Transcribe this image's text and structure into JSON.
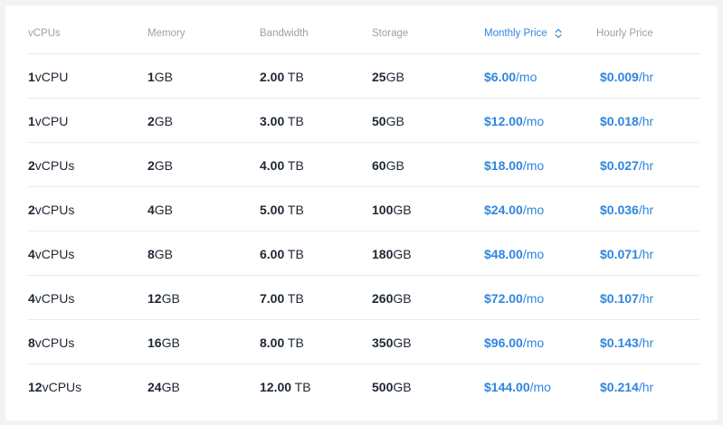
{
  "columns": {
    "vcpus": "vCPUs",
    "memory": "Memory",
    "bandwidth": "Bandwidth",
    "storage": "Storage",
    "monthly": "Monthly Price",
    "hourly": "Hourly Price"
  },
  "sort": {
    "column": "monthly",
    "icon": "sort-updown-icon"
  },
  "accent_color": "#2f86de",
  "rows": [
    {
      "vcpu_num": "1",
      "vcpu_unit": "vCPU",
      "mem_num": "1",
      "mem_unit": "GB",
      "bw_num": "2.00",
      "bw_unit": " TB",
      "st_num": "25",
      "st_unit": "GB",
      "mo_num": "$6.00",
      "mo_unit": "/mo",
      "hr_num": "$0.009",
      "hr_unit": "/hr"
    },
    {
      "vcpu_num": "1",
      "vcpu_unit": "vCPU",
      "mem_num": "2",
      "mem_unit": "GB",
      "bw_num": "3.00",
      "bw_unit": " TB",
      "st_num": "50",
      "st_unit": "GB",
      "mo_num": "$12.00",
      "mo_unit": "/mo",
      "hr_num": "$0.018",
      "hr_unit": "/hr"
    },
    {
      "vcpu_num": "2",
      "vcpu_unit": "vCPUs",
      "mem_num": "2",
      "mem_unit": "GB",
      "bw_num": "4.00",
      "bw_unit": " TB",
      "st_num": "60",
      "st_unit": "GB",
      "mo_num": "$18.00",
      "mo_unit": "/mo",
      "hr_num": "$0.027",
      "hr_unit": "/hr"
    },
    {
      "vcpu_num": "2",
      "vcpu_unit": "vCPUs",
      "mem_num": "4",
      "mem_unit": "GB",
      "bw_num": "5.00",
      "bw_unit": " TB",
      "st_num": "100",
      "st_unit": "GB",
      "mo_num": "$24.00",
      "mo_unit": "/mo",
      "hr_num": "$0.036",
      "hr_unit": "/hr"
    },
    {
      "vcpu_num": "4",
      "vcpu_unit": "vCPUs",
      "mem_num": "8",
      "mem_unit": "GB",
      "bw_num": "6.00",
      "bw_unit": " TB",
      "st_num": "180",
      "st_unit": "GB",
      "mo_num": "$48.00",
      "mo_unit": "/mo",
      "hr_num": "$0.071",
      "hr_unit": "/hr"
    },
    {
      "vcpu_num": "4",
      "vcpu_unit": "vCPUs",
      "mem_num": "12",
      "mem_unit": "GB",
      "bw_num": "7.00",
      "bw_unit": " TB",
      "st_num": "260",
      "st_unit": "GB",
      "mo_num": "$72.00",
      "mo_unit": "/mo",
      "hr_num": "$0.107",
      "hr_unit": "/hr"
    },
    {
      "vcpu_num": "8",
      "vcpu_unit": "vCPUs",
      "mem_num": "16",
      "mem_unit": "GB",
      "bw_num": "8.00",
      "bw_unit": " TB",
      "st_num": "350",
      "st_unit": "GB",
      "mo_num": "$96.00",
      "mo_unit": "/mo",
      "hr_num": "$0.143",
      "hr_unit": "/hr"
    },
    {
      "vcpu_num": "12",
      "vcpu_unit": "vCPUs",
      "mem_num": "24",
      "mem_unit": "GB",
      "bw_num": "12.00",
      "bw_unit": " TB",
      "st_num": "500",
      "st_unit": "GB",
      "mo_num": "$144.00",
      "mo_unit": "/mo",
      "hr_num": "$0.214",
      "hr_unit": "/hr"
    }
  ]
}
